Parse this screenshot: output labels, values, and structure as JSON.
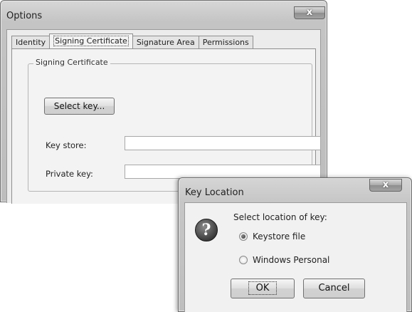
{
  "options_window": {
    "title": "Options",
    "close_glyph": "x",
    "tabs": [
      {
        "label": "Identity",
        "active": false
      },
      {
        "label": "Signing Certificate",
        "active": true
      },
      {
        "label": "Signature Area",
        "active": false
      },
      {
        "label": "Permissions",
        "active": false
      }
    ],
    "group_title": "Signing Certificate",
    "select_key_label": "Select key...",
    "key_store_label": "Key store:",
    "key_store_value": "",
    "private_key_label": "Private key:",
    "private_key_value": ""
  },
  "key_location_dialog": {
    "title": "Key Location",
    "close_glyph": "x",
    "icon": "question-icon",
    "prompt": "Select location of key:",
    "options": [
      {
        "label": "Keystore file",
        "selected": true
      },
      {
        "label": "Windows Personal",
        "selected": false
      }
    ],
    "ok_label": "OK",
    "cancel_label": "Cancel"
  }
}
